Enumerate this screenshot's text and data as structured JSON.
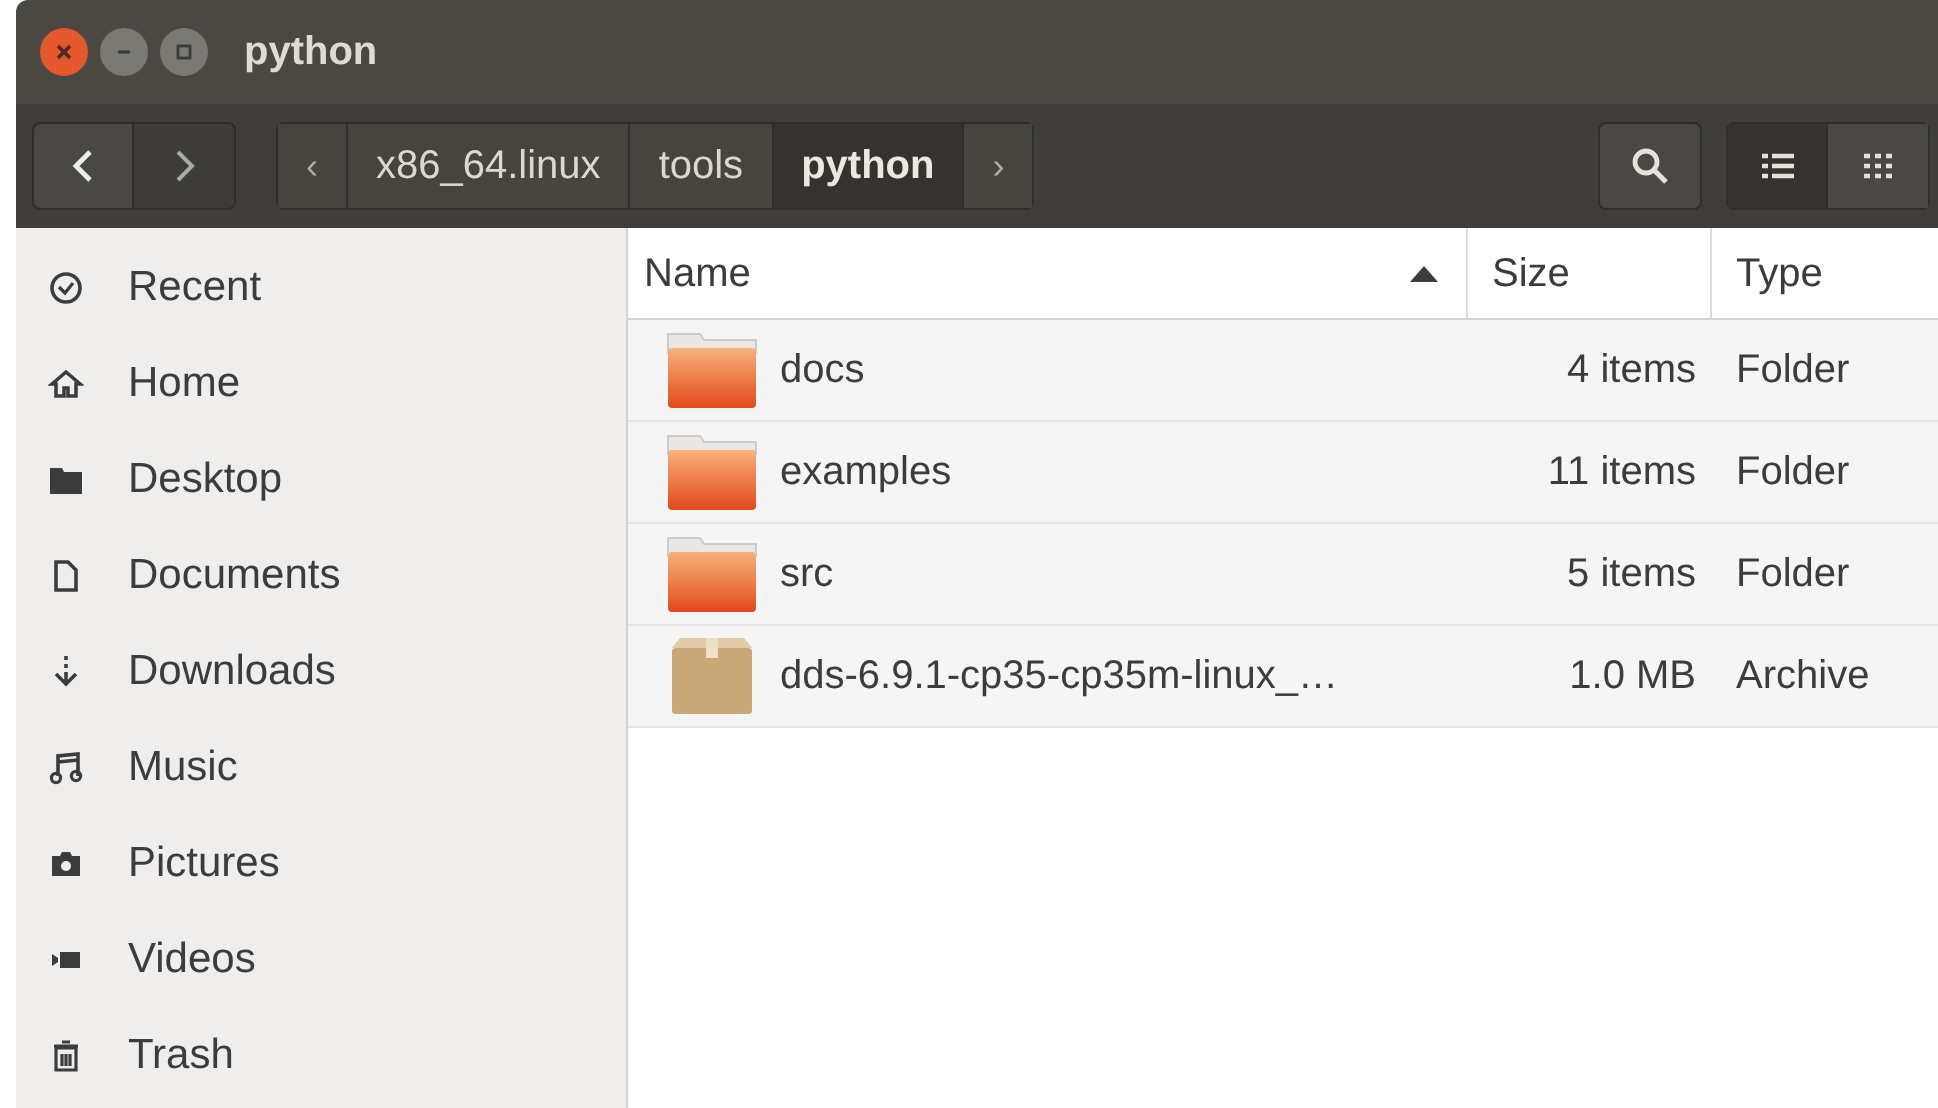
{
  "window": {
    "title": "python"
  },
  "toolbar": {
    "nav": [
      {
        "label": "‹",
        "kind": "arrow",
        "selected": false
      },
      {
        "label": "x86_64.linux",
        "kind": "path",
        "selected": false
      },
      {
        "label": "tools",
        "kind": "path",
        "selected": false
      },
      {
        "label": "python",
        "kind": "path",
        "selected": true
      },
      {
        "label": "›",
        "kind": "arrow",
        "selected": false
      }
    ],
    "views": [
      {
        "kind": "list",
        "selected": true
      },
      {
        "kind": "grid",
        "selected": false
      }
    ]
  },
  "sidebar": {
    "items": [
      {
        "label": "Recent",
        "kind": "recent"
      },
      {
        "label": "Home",
        "kind": "home"
      },
      {
        "label": "Desktop",
        "kind": "desktop"
      },
      {
        "label": "Documents",
        "kind": "documents"
      },
      {
        "label": "Downloads",
        "kind": "downloads"
      },
      {
        "label": "Music",
        "kind": "music"
      },
      {
        "label": "Pictures",
        "kind": "pictures"
      },
      {
        "label": "Videos",
        "kind": "videos"
      },
      {
        "label": "Trash",
        "kind": "trash"
      }
    ]
  },
  "table": {
    "columns": [
      "Name",
      "Size",
      "Type"
    ],
    "rows": [
      {
        "kind": "folder",
        "name": "docs",
        "size": "4 items",
        "type": "Folder"
      },
      {
        "kind": "folder",
        "name": "examples",
        "size": "11 items",
        "type": "Folder"
      },
      {
        "kind": "folder",
        "name": "src",
        "size": "5 items",
        "type": "Folder"
      },
      {
        "kind": "archive",
        "name": "dds-6.9.1-cp35-cp35m-linux_…",
        "size": "1.0 MB",
        "type": "Archive"
      }
    ]
  }
}
